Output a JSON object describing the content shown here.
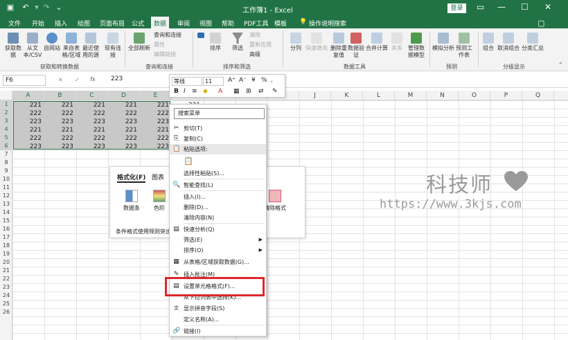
{
  "titlebar": {
    "title": "工作簿1 - Excel",
    "login": "登录",
    "bg": "#217346"
  },
  "tabs": [
    "文件",
    "开始",
    "插入",
    "绘图",
    "页面布局",
    "公式",
    "数据",
    "审阅",
    "视图",
    "帮助",
    "PDF工具",
    "模板"
  ],
  "tell_me": "操作说明搜索",
  "ribbon": {
    "get": {
      "items": [
        "获取数据",
        "从文本/CSV",
        "自网站",
        "来自表格/区域",
        "最近使用的源",
        "现有连接"
      ],
      "label": "获取和转换数据"
    },
    "query": {
      "refresh": "全部刷新",
      "items": [
        "查询和连接",
        "属性",
        "编辑链接"
      ],
      "label": "查询和连接"
    },
    "sort": {
      "items": [
        "排序",
        "筛选"
      ],
      "small": [
        "清除",
        "重新应用",
        "高级"
      ],
      "label": "排序和筛选"
    },
    "tools": {
      "items": [
        "分列",
        "快速填充",
        "删除重复值",
        "数据验证",
        "合并计算",
        "关系",
        "管理数据模型"
      ],
      "label": "数据工具"
    },
    "forecast": {
      "items": [
        "模拟分析",
        "预测工作表"
      ],
      "label": "预测"
    },
    "outline": {
      "items": [
        "组合",
        "取消组合",
        "分类汇总"
      ],
      "label": "分级显示"
    }
  },
  "formula": {
    "namebox": "F6",
    "value": "223"
  },
  "columns": [
    "A",
    "B",
    "C",
    "D",
    "E",
    "F",
    "G",
    "H",
    "I",
    "J",
    "K",
    "L",
    "M",
    "N",
    "O",
    "P",
    "Q"
  ],
  "rows": [
    "1",
    "2",
    "3",
    "4",
    "5",
    "6",
    "7",
    "8",
    "9",
    "10",
    "11",
    "12",
    "13",
    "14",
    "15",
    "16",
    "17",
    "18",
    "19",
    "20",
    "21",
    "22",
    "23",
    "24",
    "25",
    "26"
  ],
  "cells": [
    [
      "221",
      "221",
      "221",
      "221",
      "221"
    ],
    [
      "222",
      "222",
      "222",
      "222",
      "222"
    ],
    [
      "223",
      "223",
      "223",
      "223",
      "223"
    ],
    [
      "221",
      "221",
      "221",
      "221",
      "221"
    ],
    [
      "222",
      "222",
      "222",
      "222",
      "222"
    ],
    [
      "223",
      "223",
      "223",
      "223",
      "223"
    ]
  ],
  "f1_partial": "221",
  "mini_toolbar": {
    "font": "等线",
    "size": "11",
    "bold": "B",
    "italic": "I",
    "percent": "%"
  },
  "quick_panel": {
    "tabs": [
      "格式化(F)",
      "图表"
    ],
    "items": [
      "数据条",
      "色阶"
    ],
    "right_item": "清除格式",
    "footer": "条件格式使用规则突出"
  },
  "context_menu": {
    "search": "搜索菜单",
    "items": [
      {
        "label": "剪切(T)",
        "icon": "scissors-icon"
      },
      {
        "label": "复制(C)",
        "icon": "copy-icon"
      },
      {
        "label": "粘贴选项:",
        "icon": "paste-icon"
      },
      {
        "label": "选择性粘贴(S)...",
        "icon": ""
      },
      {
        "label": "智能查找(L)",
        "icon": "smart-lookup-icon"
      },
      {
        "label": "插入(I)...",
        "icon": ""
      },
      {
        "label": "删除(D)...",
        "icon": ""
      },
      {
        "label": "清除内容(N)",
        "icon": ""
      },
      {
        "label": "快速分析(Q)",
        "icon": "quick-analysis-icon"
      },
      {
        "label": "筛选(E)",
        "icon": ""
      },
      {
        "label": "排序(O)",
        "icon": ""
      },
      {
        "label": "从表格/区域获取数据(G)...",
        "icon": "table-icon"
      },
      {
        "label": "插入批注(M)",
        "icon": "comment-icon"
      },
      {
        "label": "设置单元格格式(F)...",
        "icon": "format-cells-icon"
      },
      {
        "label": "从下拉列表中选择(K)...",
        "icon": ""
      },
      {
        "label": "显示拼音字段(S)",
        "icon": "phonetic-icon"
      },
      {
        "label": "定义名称(A)...",
        "icon": ""
      },
      {
        "label": "链接(I)",
        "icon": "link-icon"
      }
    ]
  },
  "watermark": {
    "text": "科技师",
    "url": "https://www.3kjs.com"
  },
  "colors": {
    "accent": "#217346",
    "highlight": "#e0262a"
  }
}
